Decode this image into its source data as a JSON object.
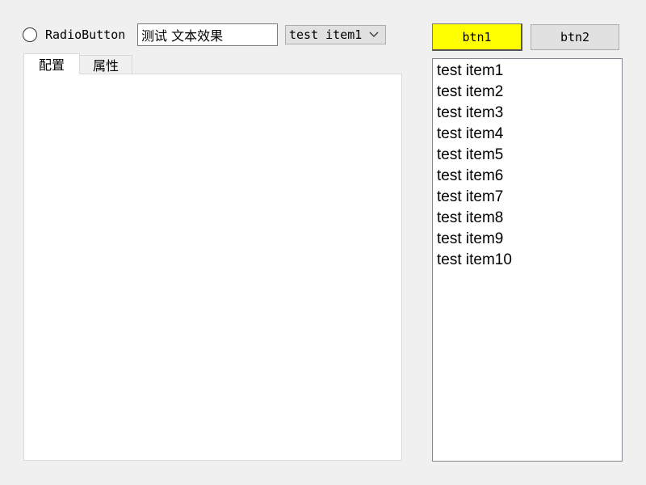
{
  "radio": {
    "label": "RadioButton",
    "checked": false
  },
  "text_edit": {
    "value": "测试 文本效果"
  },
  "combo": {
    "selected": "test item1",
    "chevron_icon": "chevron-down-icon"
  },
  "tabs": [
    {
      "label": "配置",
      "active": true
    },
    {
      "label": "属性",
      "active": false
    }
  ],
  "buttons": {
    "btn1_label": "btn1",
    "btn1_color": "#ffff00",
    "btn2_label": "btn2"
  },
  "list": {
    "items": [
      "test item1",
      "test item2",
      "test item3",
      "test item4",
      "test item5",
      "test item6",
      "test item7",
      "test item8",
      "test item9",
      "test item10"
    ]
  }
}
